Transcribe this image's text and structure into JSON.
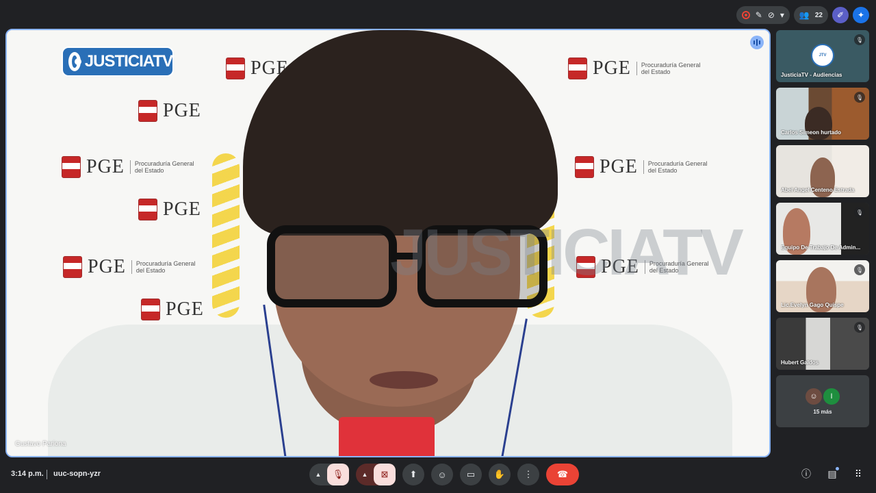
{
  "top_bar": {
    "participant_count": "22",
    "icons": [
      "record-icon",
      "edit-icon",
      "caption-off-icon",
      "dropdown-icon",
      "people-icon",
      "pen-icon",
      "gemini-icon"
    ]
  },
  "stage": {
    "logo_text": "JUSTICIATV",
    "watermark": "JUSTICIATV",
    "backdrop_brand": "PGE",
    "backdrop_sub_line1": "Procuraduría General",
    "backdrop_sub_line2": "del Estado",
    "speaker_name": "Gustavo Pariona"
  },
  "tiles": [
    {
      "name": "JusticiaTV - Audiencias",
      "muted": true
    },
    {
      "name": "Carlos Simeon hurtado",
      "muted": true
    },
    {
      "name": "Abel Angel Centeno Estrada",
      "muted": false
    },
    {
      "name": "Equipo De Trabajo De Admin...",
      "muted": true
    },
    {
      "name": "Lic.Evelyn Gago Quispe",
      "muted": true
    },
    {
      "name": "Hubert Galdos",
      "muted": true
    }
  ],
  "more": {
    "label": "15 más",
    "avatar_letter": "I"
  },
  "bottom_bar": {
    "time": "3:14 p.m.",
    "meeting_code": "uuc-sopn-yzr"
  },
  "colors": {
    "background": "#202124",
    "active_speaker_border": "#8ab4f8",
    "end_call": "#ea4335",
    "mic_off": "#f9dedc"
  }
}
